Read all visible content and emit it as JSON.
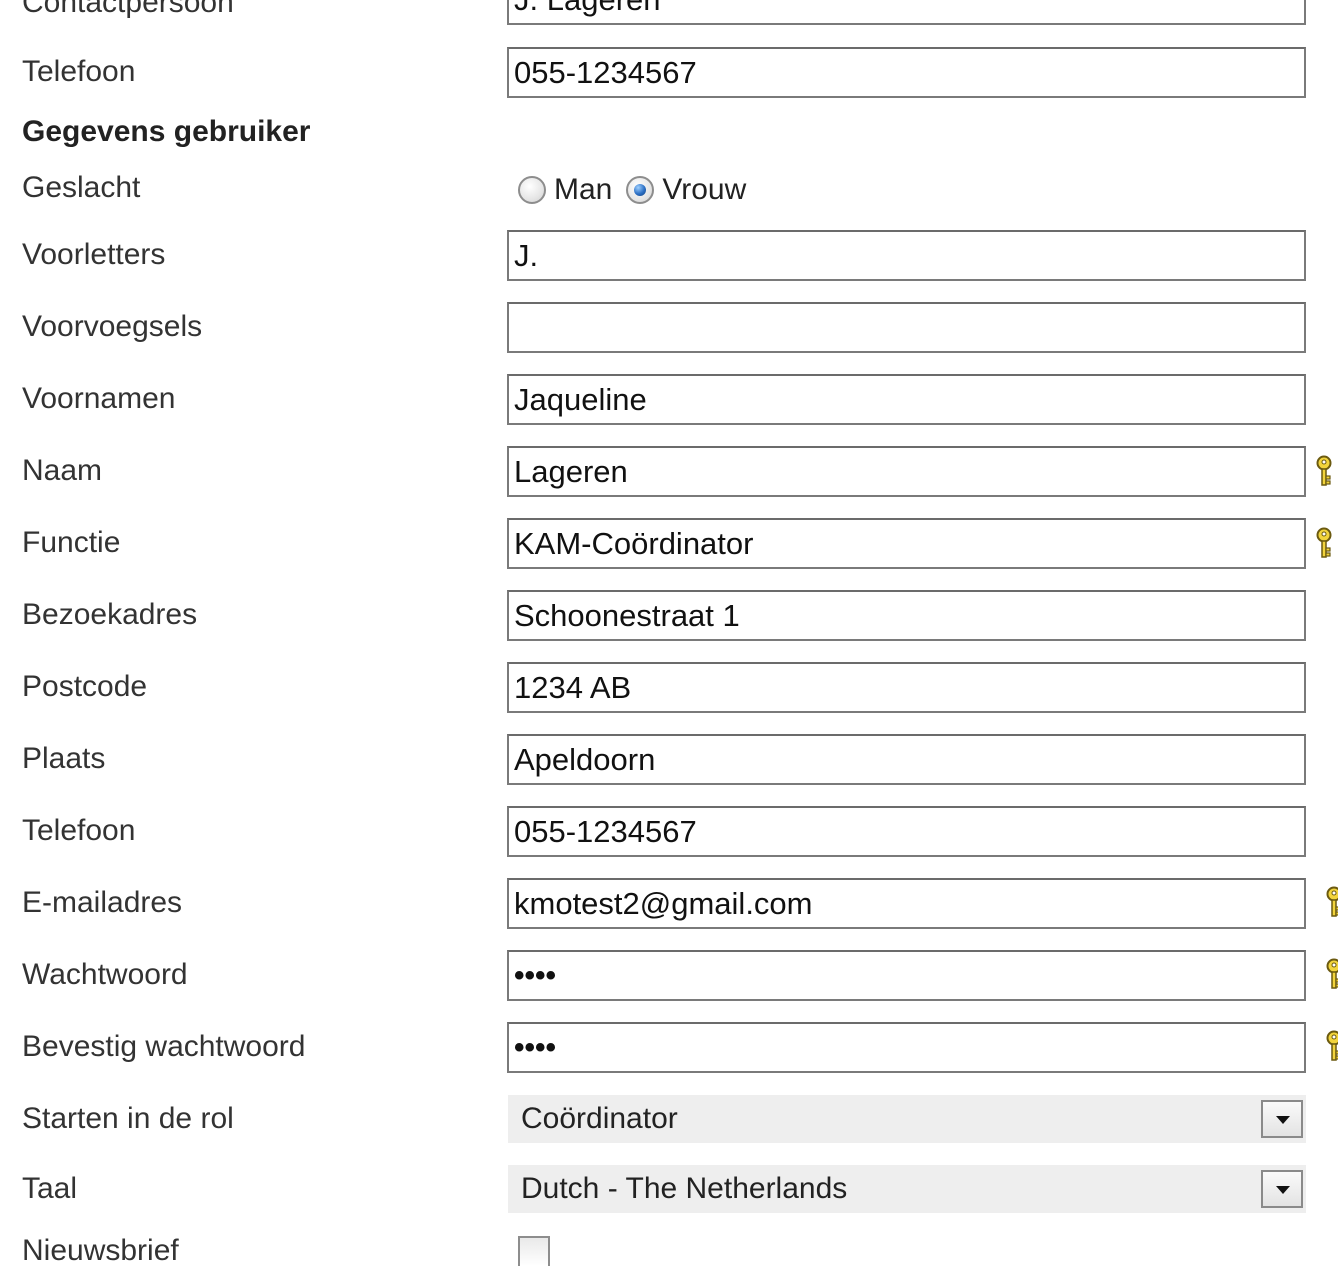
{
  "colors": {
    "text": "#333333",
    "field_border": "#7a7a7a",
    "select_bg": "#eeeeee",
    "key_icon": "#f2d43c",
    "radio_selected": "#2b6fc4"
  },
  "icons": {
    "required": "key-icon"
  },
  "labels": {
    "contactpersoon": "Contactpersoon",
    "telefoon_org": "Telefoon",
    "section_user": "Gegevens gebruiker",
    "geslacht": "Geslacht",
    "voorletters": "Voorletters",
    "voorvoegsels": "Voorvoegsels",
    "voornamen": "Voornamen",
    "naam": "Naam",
    "functie": "Functie",
    "bezoekadres": "Bezoekadres",
    "postcode": "Postcode",
    "plaats": "Plaats",
    "telefoon_user": "Telefoon",
    "email": "E-mailadres",
    "wachtwoord": "Wachtwoord",
    "bevestig": "Bevestig wachtwoord",
    "rol": "Starten in de rol",
    "taal": "Taal",
    "nieuwsbrief": "Nieuwsbrief"
  },
  "values": {
    "contactpersoon": "J. Lageren",
    "telefoon_org": "055-1234567",
    "voorletters": "J.",
    "voorvoegsels": "",
    "voornamen": "Jaqueline",
    "naam": "Lageren",
    "functie": "KAM-Coördinator",
    "bezoekadres": "Schoonestraat 1",
    "postcode": "1234 AB",
    "plaats": "Apeldoorn",
    "telefoon_user": "055-1234567",
    "email": "kmotest2@gmail.com",
    "wachtwoord_masked": "••••",
    "bevestig_masked": "••••"
  },
  "gender": {
    "options": [
      "Man",
      "Vrouw"
    ],
    "selected": "Vrouw"
  },
  "selects": {
    "rol": "Coördinator",
    "taal": "Dutch - The Netherlands"
  },
  "nieuwsbrief_checked": false
}
